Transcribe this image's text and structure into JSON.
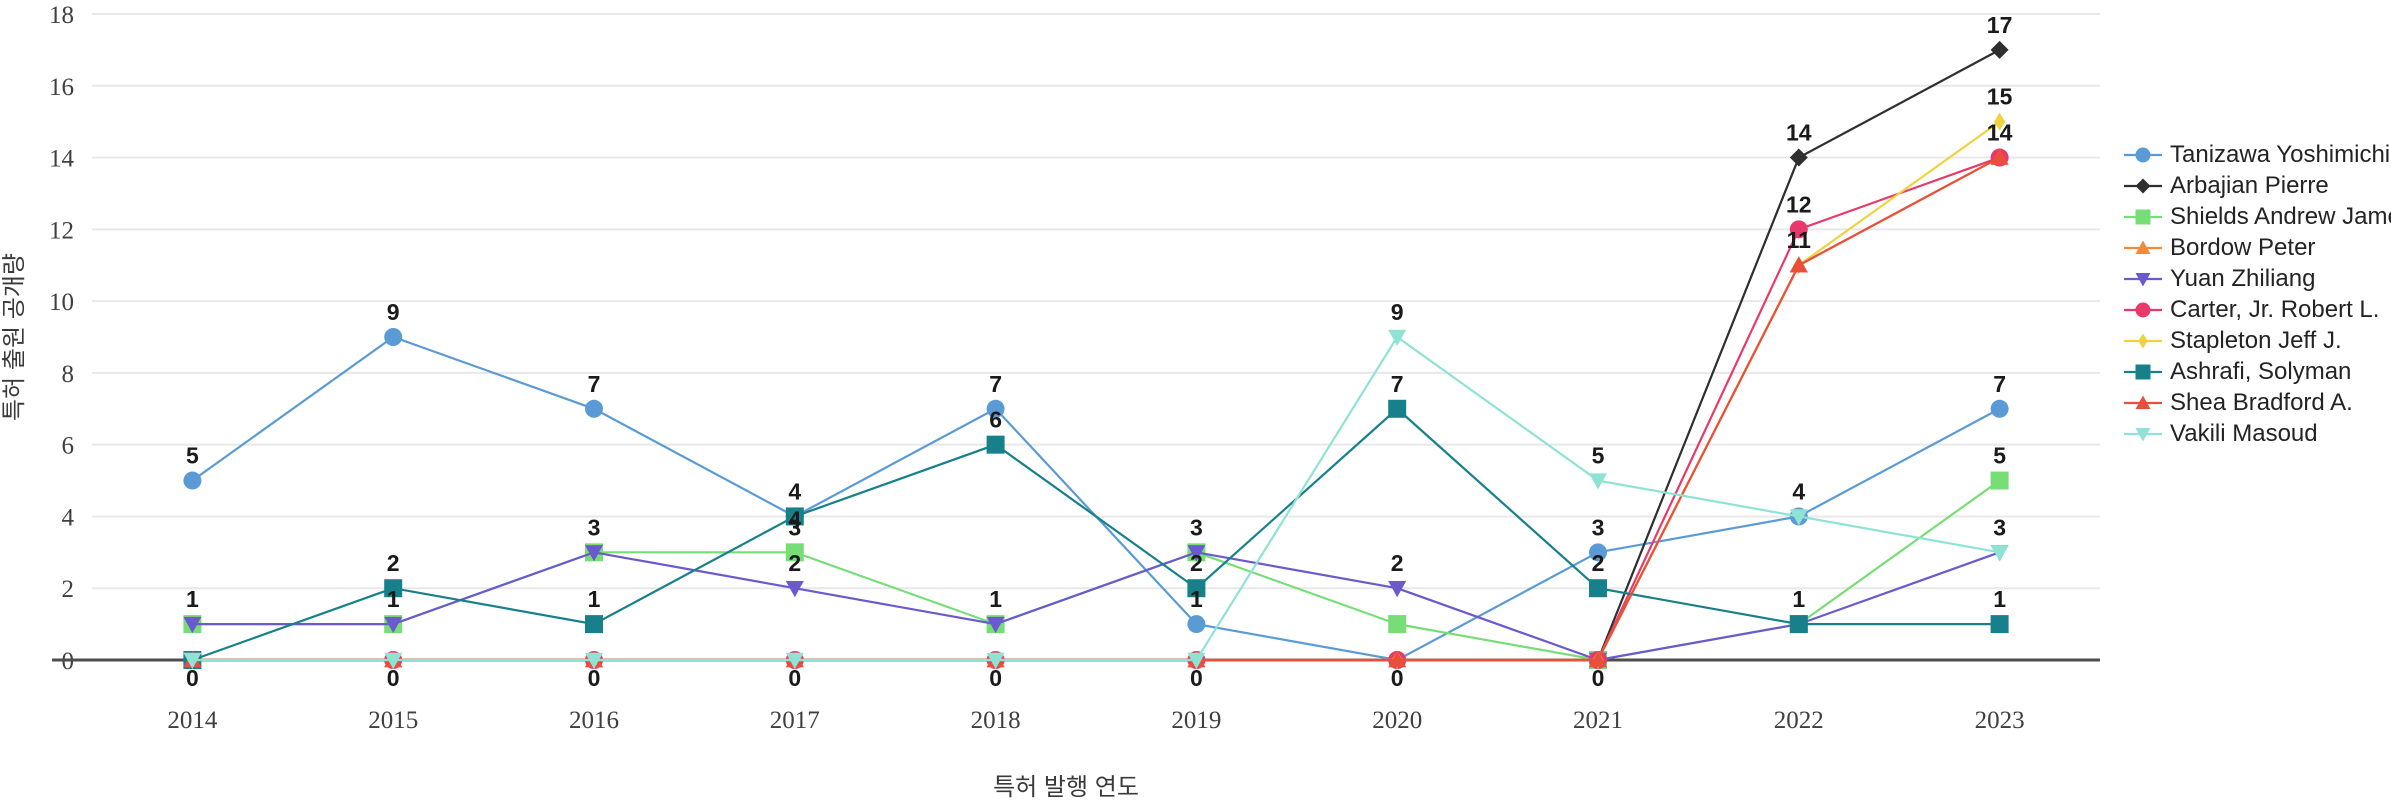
{
  "chart_data": {
    "type": "line",
    "title": "",
    "xlabel": "특허 발행 연도",
    "ylabel": "특허 출원 공개량",
    "categories": [
      "2014",
      "2015",
      "2016",
      "2017",
      "2018",
      "2019",
      "2020",
      "2021",
      "2022",
      "2023"
    ],
    "x_tick_labels": [
      "2014",
      "2015",
      "2016",
      "2017",
      "2018",
      "2019",
      "2020",
      "2021",
      "2022",
      "2023"
    ],
    "y_tick_labels": [
      "0",
      "2",
      "4",
      "6",
      "8",
      "10",
      "12",
      "14",
      "16",
      "18"
    ],
    "y_ticks": [
      0,
      2,
      4,
      6,
      8,
      10,
      12,
      14,
      16,
      18
    ],
    "ylim": [
      0,
      18
    ],
    "grid": true,
    "legend_position": "right",
    "show_point_labels": true,
    "series": [
      {
        "name": "Tanizawa Yoshimichi",
        "color": "#5B9BD5",
        "marker": "circle",
        "values": [
          5,
          9,
          7,
          4,
          7,
          1,
          0,
          3,
          4,
          7
        ]
      },
      {
        "name": "Arbajian Pierre",
        "color": "#2F2F2F",
        "marker": "diamond",
        "values": [
          0,
          0,
          0,
          0,
          0,
          0,
          0,
          0,
          14,
          17
        ]
      },
      {
        "name": "Shields Andrew James",
        "color": "#77DD77",
        "marker": "square",
        "values": [
          1,
          1,
          3,
          3,
          1,
          3,
          1,
          0,
          1,
          5
        ]
      },
      {
        "name": "Bordow Peter",
        "color": "#F08B3C",
        "marker": "triangle-up",
        "values": [
          0,
          0,
          0,
          0,
          0,
          0,
          0,
          0,
          11,
          14
        ]
      },
      {
        "name": "Yuan Zhiliang",
        "color": "#6A5ACD",
        "marker": "triangle-down",
        "values": [
          1,
          1,
          3,
          2,
          1,
          3,
          2,
          0,
          1,
          3
        ]
      },
      {
        "name": "Carter, Jr. Robert L.",
        "color": "#E8396A",
        "marker": "circle",
        "values": [
          0,
          0,
          0,
          0,
          0,
          0,
          0,
          0,
          12,
          14
        ]
      },
      {
        "name": "Stapleton Jeff J.",
        "color": "#EFD23C",
        "marker": "thin-diamond",
        "values": [
          0,
          0,
          0,
          0,
          0,
          0,
          0,
          0,
          11,
          15
        ]
      },
      {
        "name": "Ashrafi, Solyman",
        "color": "#17808A",
        "marker": "square",
        "values": [
          0,
          2,
          1,
          4,
          6,
          2,
          7,
          2,
          1,
          1
        ]
      },
      {
        "name": "Shea Bradford A.",
        "color": "#E8503C",
        "marker": "triangle-up",
        "values": [
          0,
          0,
          0,
          0,
          0,
          0,
          0,
          0,
          11,
          14
        ]
      },
      {
        "name": "Vakili Masoud",
        "color": "#8FE3D5",
        "marker": "triangle-down",
        "values": [
          0,
          0,
          0,
          0,
          0,
          0,
          9,
          5,
          4,
          3
        ]
      }
    ],
    "point_labels": [
      {
        "series": "Tanizawa Yoshimichi",
        "x": "2014",
        "value": 5,
        "text": "5"
      },
      {
        "series": "Tanizawa Yoshimichi",
        "x": "2015",
        "value": 9,
        "text": "9"
      },
      {
        "series": "Tanizawa Yoshimichi",
        "x": "2016",
        "value": 7,
        "text": "7"
      },
      {
        "series": "Tanizawa Yoshimichi",
        "x": "2017",
        "value": 4,
        "text": "4"
      },
      {
        "series": "Tanizawa Yoshimichi",
        "x": "2018",
        "value": 7,
        "text": "7"
      },
      {
        "series": "Tanizawa Yoshimichi",
        "x": "2019",
        "value": 1,
        "text": "1"
      },
      {
        "series": "Tanizawa Yoshimichi",
        "x": "2021",
        "value": 3,
        "text": "3"
      },
      {
        "series": "Tanizawa Yoshimichi",
        "x": "2022",
        "value": 4,
        "text": "4"
      },
      {
        "series": "Tanizawa Yoshimichi",
        "x": "2023",
        "value": 7,
        "text": "7"
      },
      {
        "series": "Yuan Zhiliang",
        "x": "2014",
        "value": 1,
        "text": "1"
      },
      {
        "series": "Yuan Zhiliang",
        "x": "2015",
        "value": 1,
        "text": "1"
      },
      {
        "series": "Yuan Zhiliang",
        "x": "2016",
        "value": 3,
        "text": "3"
      },
      {
        "series": "Yuan Zhiliang",
        "x": "2017",
        "value": 2,
        "text": "2"
      },
      {
        "series": "Yuan Zhiliang",
        "x": "2018",
        "value": 1,
        "text": "1"
      },
      {
        "series": "Yuan Zhiliang",
        "x": "2019",
        "value": 3,
        "text": "3"
      },
      {
        "series": "Yuan Zhiliang",
        "x": "2020",
        "value": 2,
        "text": "2"
      },
      {
        "series": "Yuan Zhiliang",
        "x": "2022",
        "value": 1,
        "text": "1"
      },
      {
        "series": "Yuan Zhiliang",
        "x": "2023",
        "value": 3,
        "text": "3"
      },
      {
        "series": "Ashrafi, Solyman",
        "x": "2015",
        "value": 2,
        "text": "2"
      },
      {
        "series": "Ashrafi, Solyman",
        "x": "2016",
        "value": 1,
        "text": "1"
      },
      {
        "series": "Ashrafi, Solyman",
        "x": "2017",
        "value": 4,
        "text": "4"
      },
      {
        "series": "Ashrafi, Solyman",
        "x": "2018",
        "value": 6,
        "text": "6"
      },
      {
        "series": "Ashrafi, Solyman",
        "x": "2019",
        "value": 2,
        "text": "2"
      },
      {
        "series": "Ashrafi, Solyman",
        "x": "2020",
        "value": 7,
        "text": "7"
      },
      {
        "series": "Ashrafi, Solyman",
        "x": "2021",
        "value": 2,
        "text": "2"
      },
      {
        "series": "Ashrafi, Solyman",
        "x": "2023",
        "value": 1,
        "text": "1"
      },
      {
        "series": "Shields Andrew James",
        "x": "2017",
        "value": 3,
        "text": "3"
      },
      {
        "series": "Shields Andrew James",
        "x": "2023",
        "value": 5,
        "text": "5"
      },
      {
        "series": "Vakili Masoud",
        "x": "2020",
        "value": 9,
        "text": "9"
      },
      {
        "series": "Vakili Masoud",
        "x": "2021",
        "value": 5,
        "text": "5"
      },
      {
        "series": "Arbajian Pierre",
        "x": "2022",
        "value": 14,
        "text": "14"
      },
      {
        "series": "Arbajian Pierre",
        "x": "2023",
        "value": 17,
        "text": "17"
      },
      {
        "series": "Carter, Jr. Robert L.",
        "x": "2022",
        "value": 12,
        "text": "12"
      },
      {
        "series": "Carter, Jr. Robert L.",
        "x": "2023",
        "value": 14,
        "text": "14"
      },
      {
        "series": "Stapleton Jeff J.",
        "x": "2022",
        "value": 11,
        "text": "11"
      },
      {
        "series": "Stapleton Jeff J.",
        "x": "2023",
        "value": 15,
        "text": "15"
      },
      {
        "series": "zero-baseline",
        "x": "2014",
        "value": 0,
        "text": "0"
      },
      {
        "series": "zero-baseline",
        "x": "2015",
        "value": 0,
        "text": "0"
      },
      {
        "series": "zero-baseline",
        "x": "2016",
        "value": 0,
        "text": "0"
      },
      {
        "series": "zero-baseline",
        "x": "2017",
        "value": 0,
        "text": "0"
      },
      {
        "series": "zero-baseline",
        "x": "2018",
        "value": 0,
        "text": "0"
      },
      {
        "series": "zero-baseline",
        "x": "2019",
        "value": 0,
        "text": "0"
      },
      {
        "series": "zero-baseline",
        "x": "2020",
        "value": 0,
        "text": "0"
      },
      {
        "series": "zero-baseline",
        "x": "2021",
        "value": 0,
        "text": "0"
      }
    ]
  },
  "legend": {
    "items": [
      {
        "label": "Tanizawa Yoshimichi"
      },
      {
        "label": "Arbajian Pierre"
      },
      {
        "label": "Shields Andrew James"
      },
      {
        "label": "Bordow Peter"
      },
      {
        "label": "Yuan Zhiliang"
      },
      {
        "label": "Carter, Jr. Robert L."
      },
      {
        "label": "Stapleton Jeff J."
      },
      {
        "label": "Ashrafi, Solyman"
      },
      {
        "label": "Shea Bradford A."
      },
      {
        "label": "Vakili Masoud"
      }
    ]
  }
}
